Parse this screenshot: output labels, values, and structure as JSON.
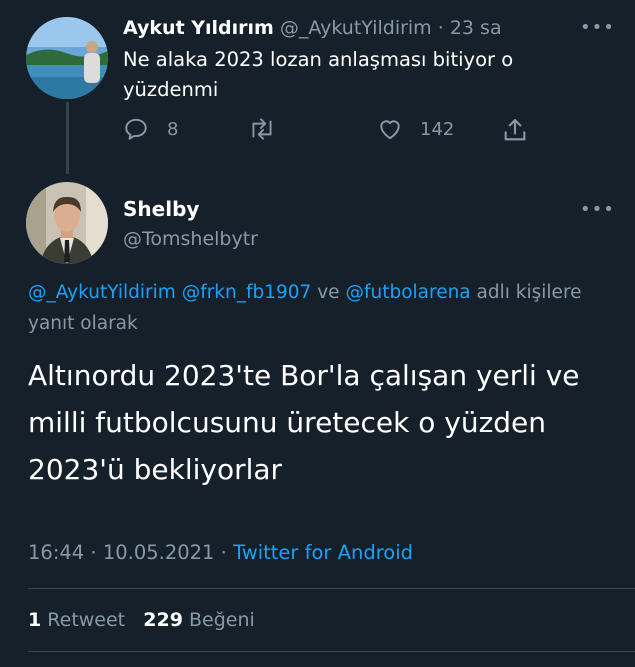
{
  "parent_tweet": {
    "name": "Aykut Yıldırım",
    "handle": "@_AykutYildirim",
    "dot": "·",
    "time": "23 sa",
    "text": "Ne alaka 2023 lozan anlaşması bitiyor o yüzdenmi",
    "replies": "8",
    "likes": "142"
  },
  "main_tweet": {
    "name": "Shelby",
    "handle": "@Tomshelbytr",
    "mentions": [
      "@_AykutYildirim",
      "@frkn_fb1907",
      "@futbolarena"
    ],
    "connector": "ve",
    "reply_suffix": "adlı kişilere yanıt olarak",
    "text": "Altınordu 2023'te Bor'la çalışan yerli ve milli futbolcusunu üretecek o yüzden 2023'ü bekliyorlar",
    "time": "16:44",
    "dot1": "·",
    "date": "10.05.2021",
    "dot2": "·",
    "source": "Twitter for Android",
    "retweets_count": "1",
    "retweets_label": "Retweet",
    "likes_count": "229",
    "likes_label": "Beğeni"
  },
  "colors": {
    "background": "#15202b",
    "secondary_text": "#8899a6",
    "link": "#1da1f2",
    "divider": "#38444d"
  },
  "icons": [
    "reply-icon",
    "retweet-icon",
    "like-icon",
    "share-icon",
    "more-icon"
  ]
}
